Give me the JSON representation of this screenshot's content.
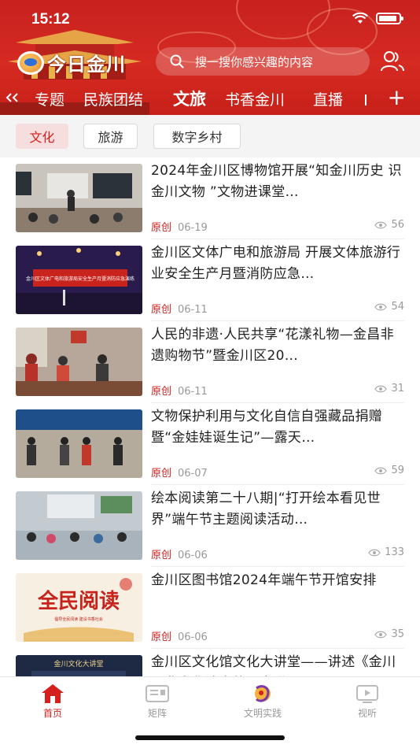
{
  "status_bar": {
    "time": "15:12"
  },
  "header": {
    "app_name": "今日金川",
    "search_placeholder": "搜一搜你感兴趣的内容"
  },
  "channels": [
    {
      "label": "专题",
      "active": false
    },
    {
      "label": "民族团结",
      "active": false
    },
    {
      "label": "文旅",
      "active": true
    },
    {
      "label": "书香金川",
      "active": false
    },
    {
      "label": "直播",
      "active": false
    },
    {
      "label": "+",
      "active": false
    }
  ],
  "subtabs": [
    {
      "label": "文化",
      "active": true
    },
    {
      "label": "旅游",
      "active": false
    },
    {
      "label": "数字乡村",
      "active": false
    }
  ],
  "articles": [
    {
      "title": "2024年金川区博物馆开展“知金川历史 识金川文物 ”文物进课堂…",
      "tag": "原创",
      "date": "06-19",
      "views": "56"
    },
    {
      "title": "金川区文体广电和旅游局 开展文体旅游行业安全生产月暨消防应急…",
      "tag": "原创",
      "date": "06-11",
      "views": "54"
    },
    {
      "title": "人民的非遗·人民共享“花漾礼物—金昌非遗购物节”暨金川区20…",
      "tag": "原创",
      "date": "06-11",
      "views": "31"
    },
    {
      "title": "文物保护利用与文化自信自强藏品捐赠暨“金娃娃诞生记”—露天…",
      "tag": "原创",
      "date": "06-07",
      "views": "59"
    },
    {
      "title": "绘本阅读第二十八期|“打开绘本看见世界”端午节主题阅读活动…",
      "tag": "原创",
      "date": "06-06",
      "views": "133"
    },
    {
      "title": "金川区图书馆2024年端午节开馆安排",
      "tag": "原创",
      "date": "06-06",
      "views": "35"
    },
    {
      "title": "金川区文化馆文化大讲堂——讲述《金川区非文化遗产的研究进展…",
      "tag": "",
      "date": "",
      "views": ""
    }
  ],
  "thumb_texts": {
    "banner2": "金川区文体广电和旅游局安全生产月暨消防应急演练",
    "reading": "全民阅读",
    "reading_sub": "倡导全民阅读 建设书香社会",
    "lecture": "金川文化大讲堂"
  },
  "tabbar": [
    {
      "label": "首页",
      "active": true
    },
    {
      "label": "矩阵",
      "active": false
    },
    {
      "label": "文明实践",
      "active": false
    },
    {
      "label": "视听",
      "active": false
    }
  ],
  "colors": {
    "brand_red": "#d4211d",
    "header_red": "#c8211e",
    "meta_gray": "#999999"
  }
}
